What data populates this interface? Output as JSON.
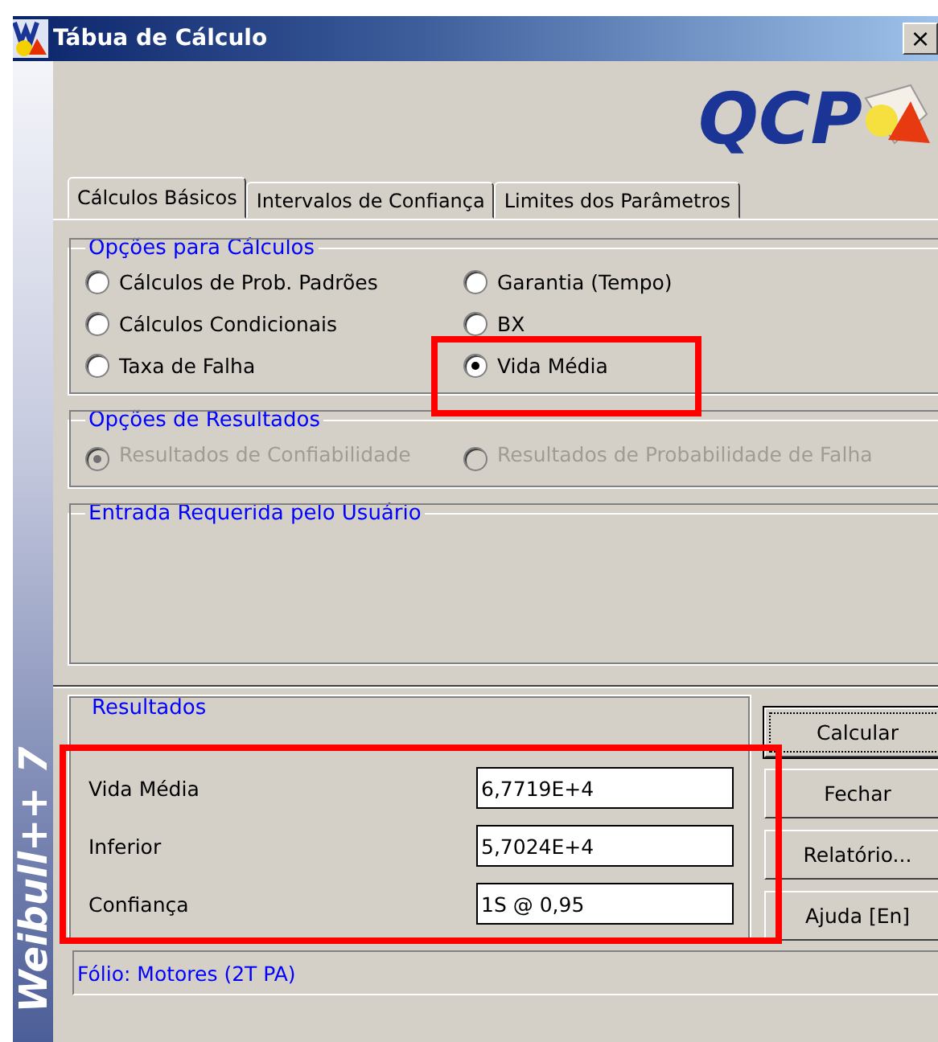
{
  "window": {
    "title": "Tábua de Cálculo",
    "close": "×"
  },
  "sidebar": {
    "product": "Weibull++ 7"
  },
  "logo": {
    "text": "QCP"
  },
  "tabs": [
    {
      "label": "Cálculos Básicos",
      "selected": true
    },
    {
      "label": "Intervalos de Confiança",
      "selected": false
    },
    {
      "label": "Limites dos Parâmetros",
      "selected": false
    }
  ],
  "calc_options": {
    "title": "Opções para Cálculos",
    "options": [
      {
        "label": "Cálculos de Prob. Padrões",
        "selected": false
      },
      {
        "label": "Garantia (Tempo)",
        "selected": false
      },
      {
        "label": "Cálculos Condicionais",
        "selected": false
      },
      {
        "label": "BX",
        "selected": false
      },
      {
        "label": "Taxa de Falha",
        "selected": false
      },
      {
        "label": "Vida Média",
        "selected": true,
        "highlighted": true
      }
    ]
  },
  "result_options": {
    "title": "Opções de Resultados",
    "disabled": true,
    "options": [
      {
        "label": "Resultados de Confiabilidade",
        "selected": true
      },
      {
        "label": "Resultados de Probabilidade de Falha",
        "selected": false
      }
    ]
  },
  "user_input": {
    "title": "Entrada Requerida pelo Usuário"
  },
  "results": {
    "title": "Resultados",
    "highlighted": true,
    "rows": [
      {
        "label": "Vida Média",
        "value": "6,7719E+4"
      },
      {
        "label": "Inferior",
        "value": "5,7024E+4"
      },
      {
        "label": "Confiança",
        "value": "1S @ 0,95"
      }
    ]
  },
  "buttons": [
    {
      "label": "Calcular",
      "default": true
    },
    {
      "label": "Fechar",
      "default": false
    },
    {
      "label": "Relatório...",
      "default": false
    },
    {
      "label": "Ajuda [En]",
      "default": false
    }
  ],
  "status_bar": {
    "text": "Fólio: Motores (2T PA)"
  }
}
